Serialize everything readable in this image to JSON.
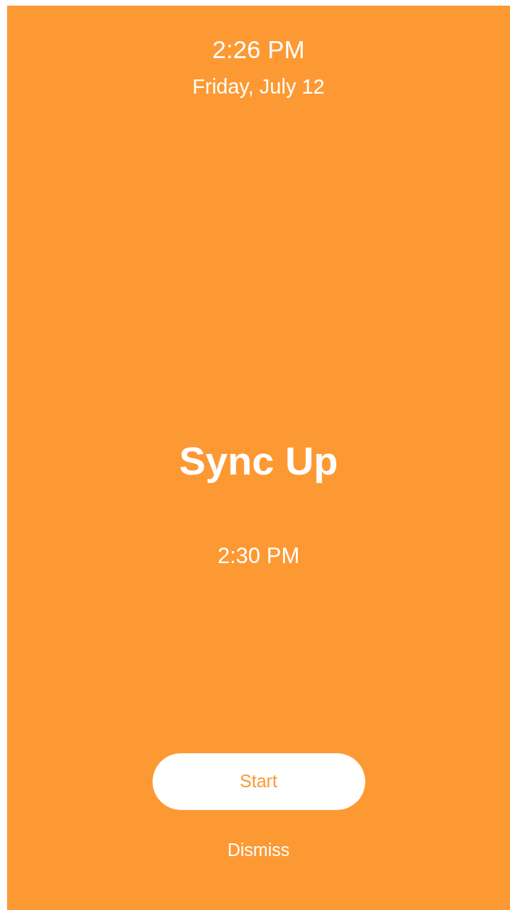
{
  "clock": {
    "time": "2:26 PM",
    "date": "Friday, July 12"
  },
  "event": {
    "title": "Sync Up",
    "time": "2:30 PM"
  },
  "buttons": [
    {
      "kind": "primary",
      "label": "Start"
    },
    {
      "kind": "text",
      "label": "Dismiss"
    }
  ]
}
